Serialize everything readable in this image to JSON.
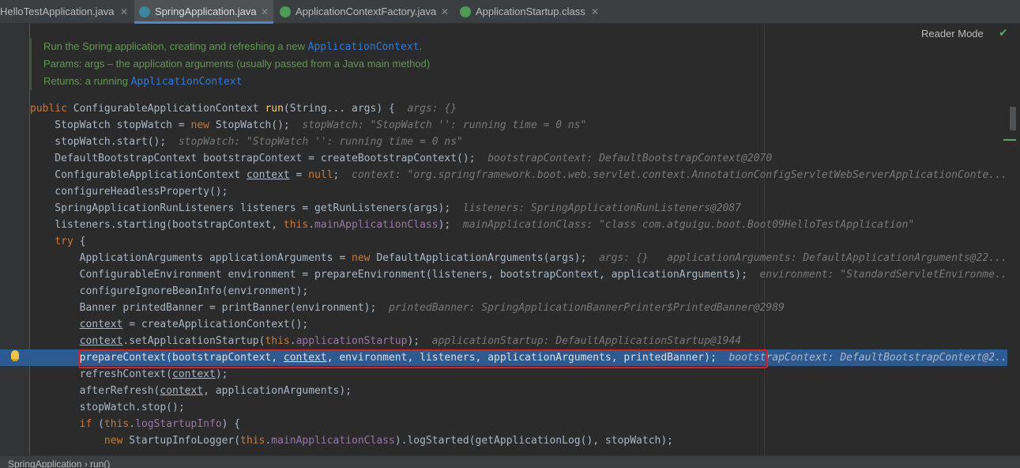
{
  "tabs": [
    {
      "label": "HelloTestApplication.java"
    },
    {
      "label": "SpringApplication.java"
    },
    {
      "label": "ApplicationContextFactory.java"
    },
    {
      "label": "ApplicationStartup.class"
    }
  ],
  "reader_mode": "Reader Mode",
  "doc": {
    "line1_text": "Run the Spring application, creating and refreshing a new ",
    "line1_link": "ApplicationContext",
    "line1_end": ".",
    "line2": "Params:  args – the application arguments (usually passed from a Java main method)",
    "line3_text": "Returns: a running ",
    "line3_link": "ApplicationContext"
  },
  "breadcrumb": "SpringApplication  ›  run()",
  "code": {
    "l1": {
      "kw": "public ",
      "type": "ConfigurableApplicationContext ",
      "fn": "run",
      "rest": "(String... args) {  ",
      "hint": "args: {}"
    },
    "l2": {
      "a": "    StopWatch stopWatch = ",
      "kw": "new ",
      "b": "StopWatch();  ",
      "hint": "stopWatch: \"StopWatch '': running time = 0 ns\""
    },
    "l3": {
      "a": "    stopWatch.start();  ",
      "hint": "stopWatch: \"StopWatch '': running time = 0 ns\""
    },
    "l4": {
      "a": "    DefaultBootstrapContext bootstrapContext = createBootstrapContext();  ",
      "hint": "bootstrapContext: DefaultBootstrapContext@2070"
    },
    "l5": {
      "a": "    ConfigurableApplicationContext ",
      "ctx": "context",
      "b": " = ",
      "kw": "null",
      "c": ";  ",
      "hint": "context: \"org.springframework.boot.web.servlet.context.AnnotationConfigServletWebServerApplicationConte..."
    },
    "l6": {
      "a": "    configureHeadlessProperty();"
    },
    "l7": {
      "a": "    SpringApplicationRunListeners listeners = getRunListeners(args);  ",
      "hint": "listeners: SpringApplicationRunListeners@2087"
    },
    "l8": {
      "a": "    listeners.starting(bootstrapContext, ",
      "kw": "this",
      "b": ".",
      "fld": "mainApplicationClass",
      "c": ");  ",
      "hint": "mainApplicationClass: \"class com.atguigu.boot.Boot09HelloTestApplication\""
    },
    "l9": {
      "kw": "    try",
      "a": " {"
    },
    "l10": {
      "a": "        ApplicationArguments applicationArguments = ",
      "kw": "new ",
      "b": "DefaultApplicationArguments(args);  ",
      "hint": "args: {}   applicationArguments: DefaultApplicationArguments@22..."
    },
    "l11": {
      "a": "        ConfigurableEnvironment environment = prepareEnvironment(listeners, bootstrapContext, applicationArguments);  ",
      "hint": "environment: \"StandardServletEnvironme..."
    },
    "l12": {
      "a": "        configureIgnoreBeanInfo(environment);"
    },
    "l13": {
      "a": "        Banner printedBanner = printBanner(environment);  ",
      "hint": "printedBanner: SpringApplicationBannerPrinter$PrintedBanner@2989"
    },
    "l14": {
      "ctx": "context",
      "a": " = createApplicationContext();"
    },
    "l15": {
      "ctx": "context",
      "a": ".setApplicationStartup(",
      "kw": "this",
      "b": ".",
      "fld": "applicationStartup",
      "c": ");  ",
      "hint": "applicationStartup: DefaultApplicationStartup@1944"
    },
    "l16": {
      "a": "        prepareContext(bootstrapContext, ",
      "ctx": "context",
      "b": ", environment, listeners, applicationArguments, printedBanner);  ",
      "hint": "bootstrapContext: DefaultBootstrapContext@2..."
    },
    "l17": {
      "a": "        refreshContext(",
      "ctx": "context",
      "b": ");"
    },
    "l18": {
      "a": "        afterRefresh(",
      "ctx": "context",
      "b": ", applicationArguments);"
    },
    "l19": {
      "a": "        stopWatch.stop();"
    },
    "l20": {
      "kw": "        if",
      "a": " (",
      "kw2": "this",
      "b": ".",
      "fld": "logStartupInfo",
      "c": ") {"
    },
    "l21": {
      "kw": "            new ",
      "a": "StartupInfoLogger(",
      "kw2": "this",
      "b": ".",
      "fld": "mainApplicationClass",
      "c": ").logStarted(getApplicationLog(), stopWatch);"
    }
  },
  "colors": {
    "keyword": "#cc7832",
    "method": "#ffc66d",
    "field": "#9876aa",
    "hint": "#787878",
    "doc": "#629755",
    "link": "#287bde",
    "highlight": "#2d5b91",
    "redbox": "#e31c1c"
  }
}
